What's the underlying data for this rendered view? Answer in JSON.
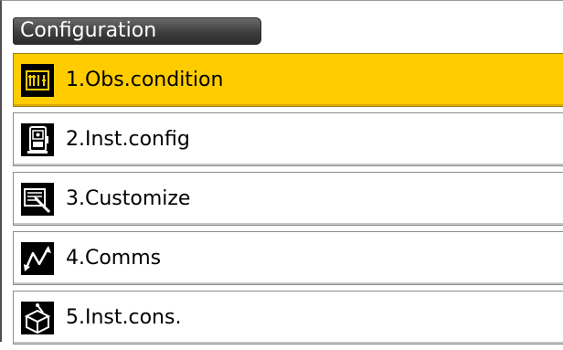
{
  "title": "Configuration",
  "menu": {
    "selected_index": 0,
    "items": [
      {
        "label": "1.Obs.condition",
        "icon": "obs-condition-icon"
      },
      {
        "label": "2.Inst.config",
        "icon": "instrument-icon"
      },
      {
        "label": "3.Customize",
        "icon": "customize-icon"
      },
      {
        "label": "4.Comms",
        "icon": "comms-icon"
      },
      {
        "label": "5.Inst.cons.",
        "icon": "inst-constants-icon"
      }
    ]
  },
  "colors": {
    "selected_background": "#ffcc00",
    "title_background": "#3e3e3e",
    "icon_background": "#000000"
  }
}
